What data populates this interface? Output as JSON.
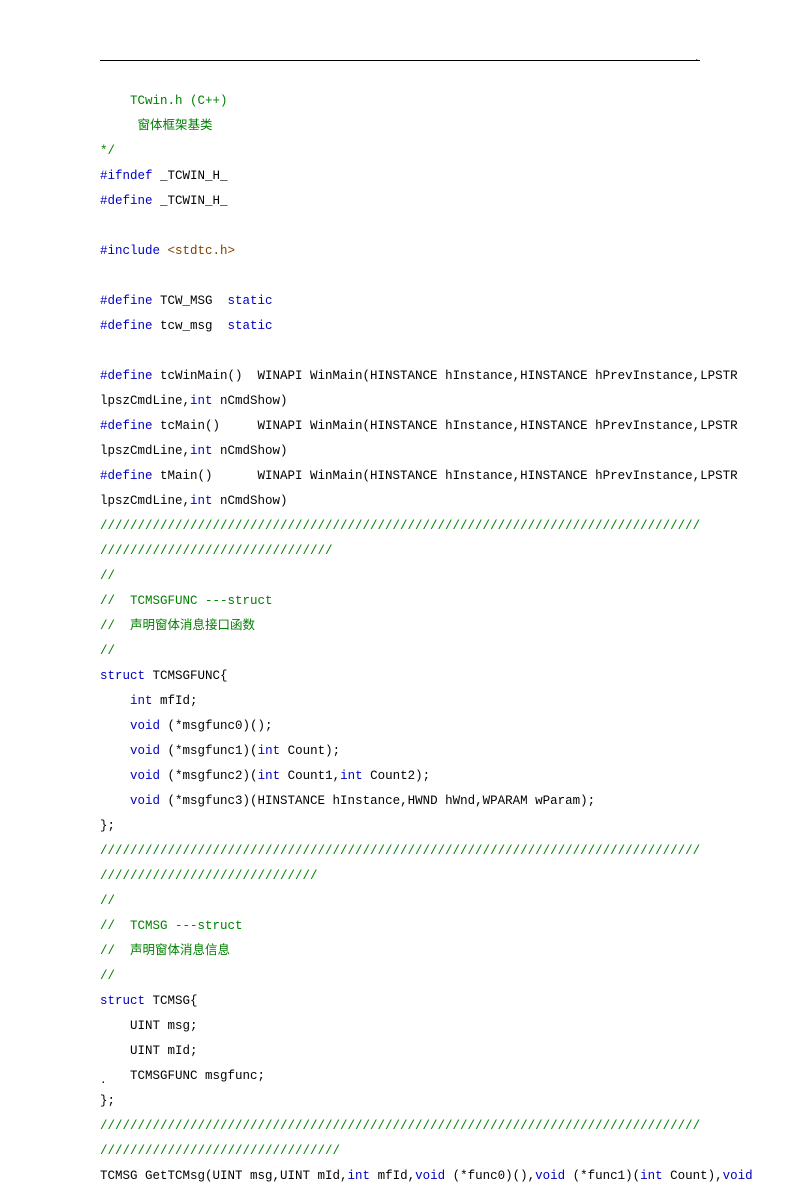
{
  "lines": [
    {
      "indent": "    ",
      "parts": [
        {
          "cls": "c-green",
          "text": "TCwin.h (C++)"
        }
      ]
    },
    {
      "indent": "    ",
      "parts": [
        {
          "cls": "c-green",
          "text": " 窗体框架基类"
        }
      ]
    },
    {
      "indent": "",
      "parts": [
        {
          "cls": "c-green",
          "text": "*/"
        }
      ]
    },
    {
      "indent": "",
      "parts": [
        {
          "cls": "c-blue",
          "text": "#ifndef"
        },
        {
          "cls": "",
          "text": " _TCWIN_H_"
        }
      ]
    },
    {
      "indent": "",
      "parts": [
        {
          "cls": "c-blue",
          "text": "#define"
        },
        {
          "cls": "",
          "text": " _TCWIN_H_"
        }
      ]
    },
    {
      "indent": "",
      "parts": [
        {
          "cls": "",
          "text": " "
        }
      ]
    },
    {
      "indent": "",
      "parts": [
        {
          "cls": "c-blue",
          "text": "#include"
        },
        {
          "cls": "",
          "text": " "
        },
        {
          "cls": "c-brown",
          "text": "<stdtc.h>"
        }
      ]
    },
    {
      "indent": "",
      "parts": [
        {
          "cls": "",
          "text": " "
        }
      ]
    },
    {
      "indent": "",
      "parts": [
        {
          "cls": "c-blue",
          "text": "#define"
        },
        {
          "cls": "",
          "text": " TCW_MSG  "
        },
        {
          "cls": "c-blue",
          "text": "static"
        }
      ]
    },
    {
      "indent": "",
      "parts": [
        {
          "cls": "c-blue",
          "text": "#define"
        },
        {
          "cls": "",
          "text": " tcw_msg  "
        },
        {
          "cls": "c-blue",
          "text": "static"
        }
      ]
    },
    {
      "indent": "",
      "parts": [
        {
          "cls": "",
          "text": " "
        }
      ]
    },
    {
      "indent": "",
      "parts": [
        {
          "cls": "c-blue",
          "text": "#define"
        },
        {
          "cls": "",
          "text": " tcWinMain()  WINAPI WinMain(HINSTANCE hInstance,HINSTANCE hPrevInstance,LPSTR"
        }
      ]
    },
    {
      "indent": "",
      "parts": [
        {
          "cls": "",
          "text": "lpszCmdLine,"
        },
        {
          "cls": "c-blue",
          "text": "int"
        },
        {
          "cls": "",
          "text": " nCmdShow)"
        }
      ]
    },
    {
      "indent": "",
      "parts": [
        {
          "cls": "c-blue",
          "text": "#define"
        },
        {
          "cls": "",
          "text": " tcMain()     WINAPI WinMain(HINSTANCE hInstance,HINSTANCE hPrevInstance,LPSTR"
        }
      ]
    },
    {
      "indent": "",
      "parts": [
        {
          "cls": "",
          "text": "lpszCmdLine,"
        },
        {
          "cls": "c-blue",
          "text": "int"
        },
        {
          "cls": "",
          "text": " nCmdShow)"
        }
      ]
    },
    {
      "indent": "",
      "parts": [
        {
          "cls": "c-blue",
          "text": "#define"
        },
        {
          "cls": "",
          "text": " tMain()      WINAPI WinMain(HINSTANCE hInstance,HINSTANCE hPrevInstance,LPSTR"
        }
      ]
    },
    {
      "indent": "",
      "parts": [
        {
          "cls": "",
          "text": "lpszCmdLine,"
        },
        {
          "cls": "c-blue",
          "text": "int"
        },
        {
          "cls": "",
          "text": " nCmdShow)"
        }
      ]
    },
    {
      "indent": "",
      "parts": [
        {
          "cls": "c-green",
          "text": "////////////////////////////////////////////////////////////////////////////////"
        }
      ]
    },
    {
      "indent": "",
      "parts": [
        {
          "cls": "c-green",
          "text": "///////////////////////////////"
        }
      ]
    },
    {
      "indent": "",
      "parts": [
        {
          "cls": "c-green",
          "text": "//"
        }
      ]
    },
    {
      "indent": "",
      "parts": [
        {
          "cls": "c-green",
          "text": "//  TCMSGFUNC ---struct"
        }
      ]
    },
    {
      "indent": "",
      "parts": [
        {
          "cls": "c-green",
          "text": "//  声明窗体消息接口函数"
        }
      ]
    },
    {
      "indent": "",
      "parts": [
        {
          "cls": "c-green",
          "text": "//"
        }
      ]
    },
    {
      "indent": "",
      "parts": [
        {
          "cls": "c-blue",
          "text": "struct"
        },
        {
          "cls": "",
          "text": " TCMSGFUNC{"
        }
      ]
    },
    {
      "indent": "    ",
      "parts": [
        {
          "cls": "c-blue",
          "text": "int"
        },
        {
          "cls": "",
          "text": " mfId;"
        }
      ]
    },
    {
      "indent": "    ",
      "parts": [
        {
          "cls": "c-blue",
          "text": "void"
        },
        {
          "cls": "",
          "text": " (*msgfunc0)();"
        }
      ]
    },
    {
      "indent": "    ",
      "parts": [
        {
          "cls": "c-blue",
          "text": "void"
        },
        {
          "cls": "",
          "text": " (*msgfunc1)("
        },
        {
          "cls": "c-blue",
          "text": "int"
        },
        {
          "cls": "",
          "text": " Count);"
        }
      ]
    },
    {
      "indent": "    ",
      "parts": [
        {
          "cls": "c-blue",
          "text": "void"
        },
        {
          "cls": "",
          "text": " (*msgfunc2)("
        },
        {
          "cls": "c-blue",
          "text": "int"
        },
        {
          "cls": "",
          "text": " Count1,"
        },
        {
          "cls": "c-blue",
          "text": "int"
        },
        {
          "cls": "",
          "text": " Count2);"
        }
      ]
    },
    {
      "indent": "    ",
      "parts": [
        {
          "cls": "c-blue",
          "text": "void"
        },
        {
          "cls": "",
          "text": " (*msgfunc3)(HINSTANCE hInstance,HWND hWnd,WPARAM wParam);"
        }
      ]
    },
    {
      "indent": "",
      "parts": [
        {
          "cls": "",
          "text": "};"
        }
      ]
    },
    {
      "indent": "",
      "parts": [
        {
          "cls": "c-green",
          "text": "////////////////////////////////////////////////////////////////////////////////"
        }
      ]
    },
    {
      "indent": "",
      "parts": [
        {
          "cls": "c-green",
          "text": "/////////////////////////////"
        }
      ]
    },
    {
      "indent": "",
      "parts": [
        {
          "cls": "c-green",
          "text": "//"
        }
      ]
    },
    {
      "indent": "",
      "parts": [
        {
          "cls": "c-green",
          "text": "//  TCMSG ---struct"
        }
      ]
    },
    {
      "indent": "",
      "parts": [
        {
          "cls": "c-green",
          "text": "//  声明窗体消息信息"
        }
      ]
    },
    {
      "indent": "",
      "parts": [
        {
          "cls": "c-green",
          "text": "//"
        }
      ]
    },
    {
      "indent": "",
      "parts": [
        {
          "cls": "c-blue",
          "text": "struct"
        },
        {
          "cls": "",
          "text": " TCMSG{"
        }
      ]
    },
    {
      "indent": "    ",
      "parts": [
        {
          "cls": "",
          "text": "UINT msg;"
        }
      ]
    },
    {
      "indent": "    ",
      "parts": [
        {
          "cls": "",
          "text": "UINT mId;"
        }
      ]
    },
    {
      "indent": "    ",
      "parts": [
        {
          "cls": "",
          "text": "TCMSGFUNC msgfunc;"
        }
      ]
    },
    {
      "indent": "",
      "parts": [
        {
          "cls": "",
          "text": "};"
        }
      ]
    },
    {
      "indent": "",
      "parts": [
        {
          "cls": "c-green",
          "text": "////////////////////////////////////////////////////////////////////////////////"
        }
      ]
    },
    {
      "indent": "",
      "parts": [
        {
          "cls": "c-green",
          "text": "////////////////////////////////"
        }
      ]
    },
    {
      "indent": "",
      "parts": [
        {
          "cls": "",
          "text": "TCMSG GetTCMsg(UINT msg,UINT mId,"
        },
        {
          "cls": "c-blue",
          "text": "int"
        },
        {
          "cls": "",
          "text": " mfId,"
        },
        {
          "cls": "c-blue",
          "text": "void"
        },
        {
          "cls": "",
          "text": " (*func0)(),"
        },
        {
          "cls": "c-blue",
          "text": "void"
        },
        {
          "cls": "",
          "text": " (*func1)("
        },
        {
          "cls": "c-blue",
          "text": "int"
        },
        {
          "cls": "",
          "text": " Count),"
        },
        {
          "cls": "c-blue",
          "text": "void"
        }
      ]
    }
  ],
  "topDot": ".",
  "footerDot": "."
}
